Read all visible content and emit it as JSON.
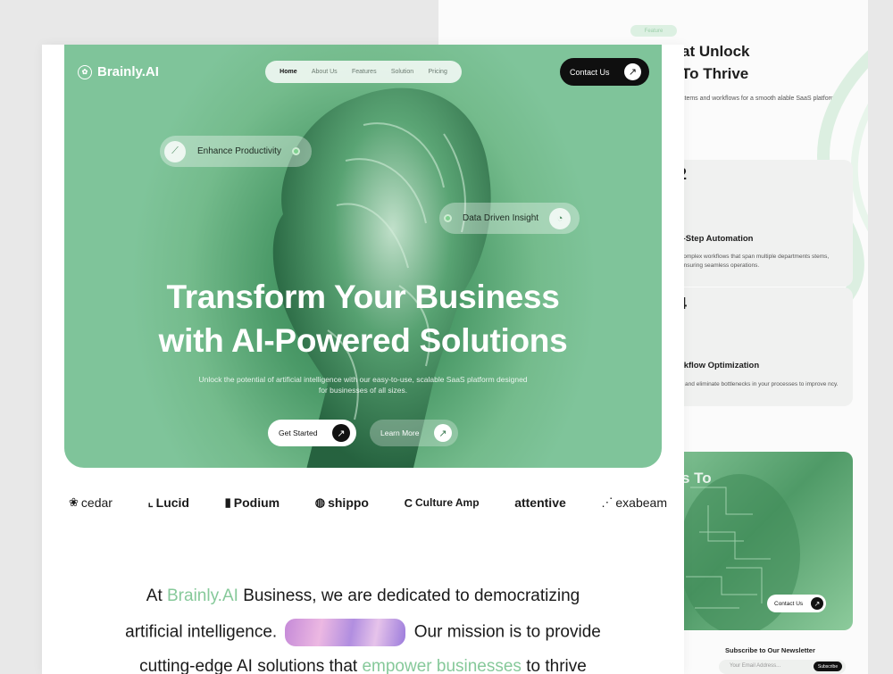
{
  "back_page": {
    "tag": "Feature",
    "heading_line1": "at Unlock",
    "heading_line2": "To Thrive",
    "intro": "stems and workflows for a smooth alable SaaS platform.",
    "cards": [
      {
        "num": "2",
        "title": "i-Step Automation",
        "desc": "complex workflows that span multiple departments stems, ensuring seamless operations."
      },
      {
        "num": "4",
        "title": "rkflow Optimization",
        "desc": "y and eliminate bottlenecks in your processes to improve ncy."
      }
    ],
    "green_card_title": "s To",
    "green_card_button": "Contact Us",
    "newsletter_title": "Subscribe to Our Newsletter",
    "newsletter_placeholder": "Your Email Address...",
    "newsletter_button": "Subscribe"
  },
  "brand": {
    "name": "Brainly.AI"
  },
  "nav": {
    "items": [
      "Home",
      "About Us",
      "Features",
      "Solution",
      "Pricing"
    ],
    "active": "Home"
  },
  "contact_label": "Contact Us",
  "chips": {
    "productivity": "Enhance Productivity",
    "insight": "Data Driven Insight"
  },
  "hero": {
    "headline_line1": "Transform Your Business",
    "headline_line2": "with AI-Powered Solutions",
    "subtext": "Unlock the potential of artificial intelligence with our easy-to-use, scalable SaaS platform designed for businesses of all sizes.",
    "get_started": "Get Started",
    "learn_more": "Learn More"
  },
  "partners": [
    "cedar",
    "Lucid",
    "Podium",
    "shippo",
    "Culture Amp",
    "attentive",
    "exabeam"
  ],
  "mission": {
    "line1_pre": "At",
    "line1_brand": "Brainly.AI",
    "line1_post": "Business, we are dedicated to democratizing",
    "line2_pre": "artificial intelligence.",
    "line2_post": "Our mission is to provide",
    "line3_pre": "cutting-edge AI solutions that",
    "line3_accent": "empower businesses",
    "line3_post": "to thrive"
  },
  "colors": {
    "accent": "#86c99a",
    "hero_green": "#5fa97a",
    "dark": "#0f0f0f"
  }
}
